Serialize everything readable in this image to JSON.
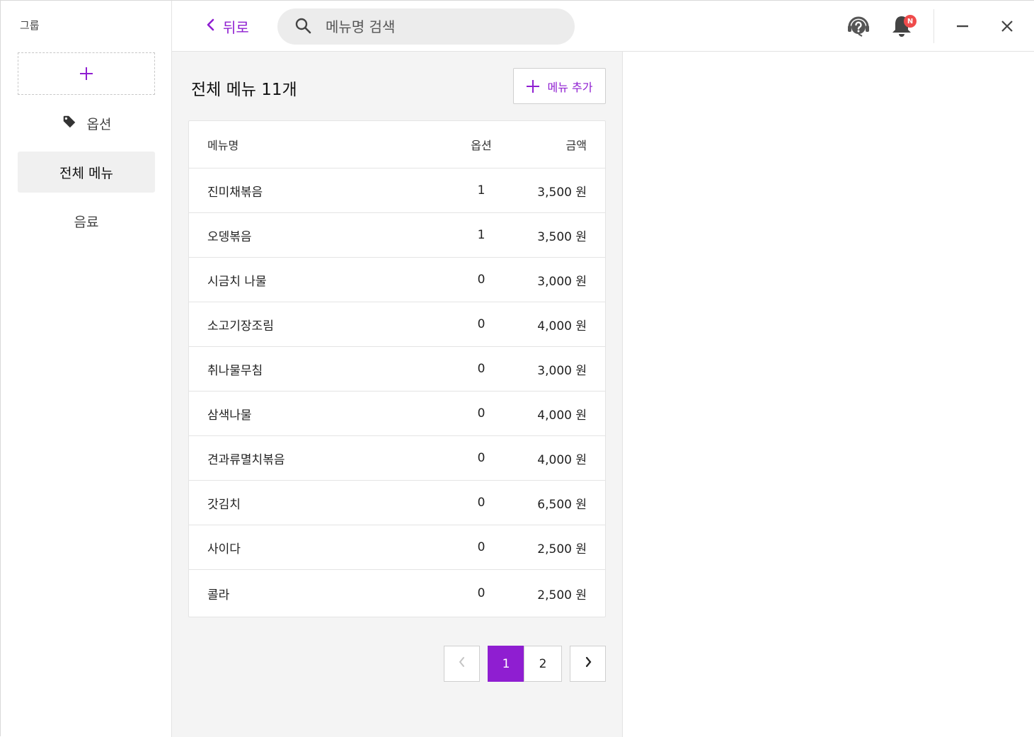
{
  "sidebar": {
    "title": "그룹",
    "items": [
      {
        "label": "옵션",
        "icon": "tag-icon"
      },
      {
        "label": "전체 메뉴"
      },
      {
        "label": "음료"
      }
    ]
  },
  "topbar": {
    "back_label": "뒤로",
    "search_placeholder": "메뉴명 검색",
    "notification_badge": "N"
  },
  "main": {
    "title": "전체 메뉴 11개",
    "add_button_label": "메뉴 추가",
    "table": {
      "headers": [
        "메뉴명",
        "옵션",
        "금액"
      ],
      "rows": [
        {
          "name": "진미채볶음",
          "options": "1",
          "price": "3,500 원"
        },
        {
          "name": "오뎅볶음",
          "options": "1",
          "price": "3,500 원"
        },
        {
          "name": "시금치 나물",
          "options": "0",
          "price": "3,000 원"
        },
        {
          "name": "소고기장조림",
          "options": "0",
          "price": "4,000 원"
        },
        {
          "name": "취나물무침",
          "options": "0",
          "price": "3,000 원"
        },
        {
          "name": "삼색나물",
          "options": "0",
          "price": "4,000 원"
        },
        {
          "name": "견과류멸치볶음",
          "options": "0",
          "price": "4,000 원"
        },
        {
          "name": "갓김치",
          "options": "0",
          "price": "6,500 원"
        },
        {
          "name": "사이다",
          "options": "0",
          "price": "2,500 원"
        },
        {
          "name": "콜라",
          "options": "0",
          "price": "2,500 원"
        }
      ]
    },
    "pagination": {
      "pages": [
        "1",
        "2"
      ],
      "current": "1"
    }
  },
  "colors": {
    "accent": "#8f1ed1",
    "badge": "#ef4b4b"
  }
}
